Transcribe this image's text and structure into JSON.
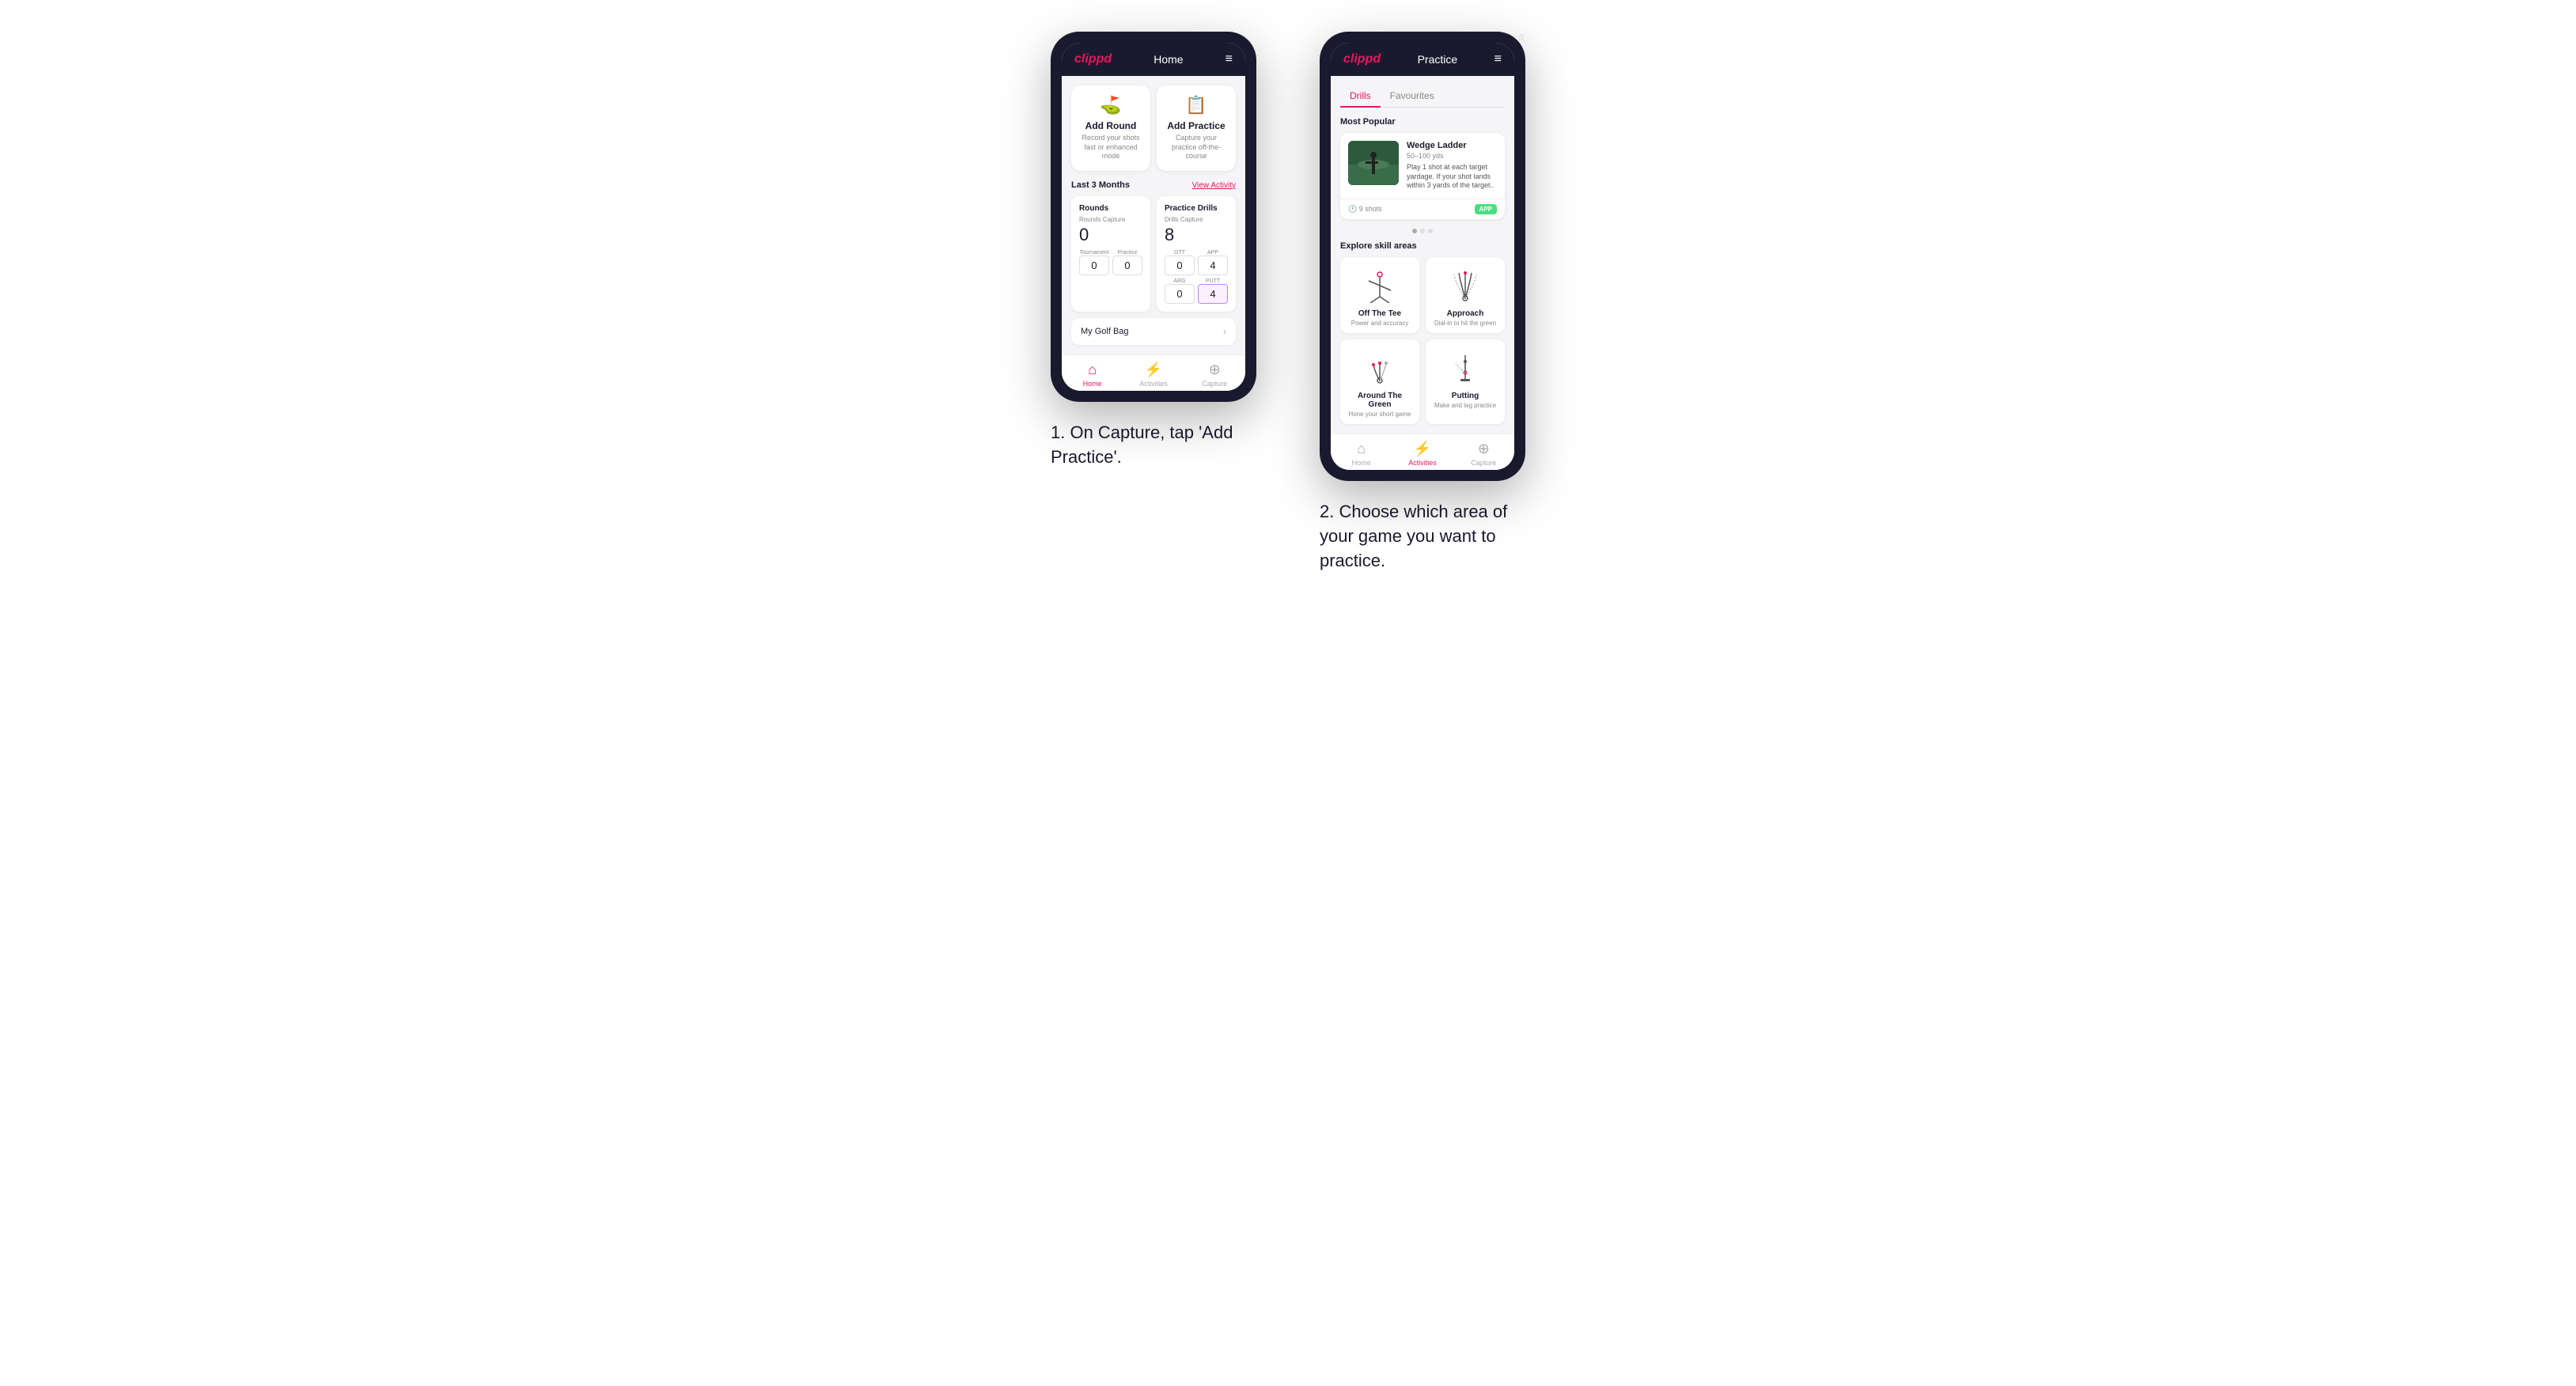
{
  "page": {
    "background": "#ffffff"
  },
  "phone1": {
    "header": {
      "logo": "clippd",
      "title": "Home",
      "menu_icon": "≡"
    },
    "action_cards": [
      {
        "id": "add-round",
        "icon": "⛳",
        "title": "Add Round",
        "subtitle": "Record your shots fast or enhanced mode"
      },
      {
        "id": "add-practice",
        "icon": "📋",
        "title": "Add Practice",
        "subtitle": "Capture your practice off-the-course"
      }
    ],
    "stats_section": {
      "label": "Last 3 Months",
      "view_activity": "View Activity",
      "rounds": {
        "title": "Rounds",
        "capture_label": "Rounds Capture",
        "value": "0",
        "tournament_label": "Tournament",
        "tournament_value": "0",
        "practice_label": "Practice",
        "practice_value": "0"
      },
      "practice_drills": {
        "title": "Practice Drills",
        "capture_label": "Drills Capture",
        "value": "8",
        "ott_label": "OTT",
        "ott_value": "0",
        "app_label": "APP",
        "app_value": "4",
        "arg_label": "ARG",
        "arg_value": "0",
        "putt_label": "PUTT",
        "putt_value": "4"
      }
    },
    "golf_bag": {
      "label": "My Golf Bag"
    },
    "bottom_nav": [
      {
        "label": "Home",
        "icon": "⌂",
        "active": true
      },
      {
        "label": "Activities",
        "icon": "⚡",
        "active": false
      },
      {
        "label": "Capture",
        "icon": "⊕",
        "active": false
      }
    ]
  },
  "phone2": {
    "header": {
      "logo": "clippd",
      "title": "Practice",
      "menu_icon": "≡"
    },
    "tabs": [
      {
        "label": "Drills",
        "active": true
      },
      {
        "label": "Favourites",
        "active": false
      }
    ],
    "most_popular_label": "Most Popular",
    "featured_drill": {
      "title": "Wedge Ladder",
      "yardage": "50–100 yds",
      "description": "Play 1 shot at each target yardage. If your shot lands within 3 yards of the target..",
      "shots_label": "9 shots",
      "badge": "APP"
    },
    "explore_label": "Explore skill areas",
    "skill_areas": [
      {
        "id": "off-the-tee",
        "title": "Off The Tee",
        "subtitle": "Power and accuracy"
      },
      {
        "id": "approach",
        "title": "Approach",
        "subtitle": "Dial-in to hit the green"
      },
      {
        "id": "around-the-green",
        "title": "Around The Green",
        "subtitle": "Hone your short game"
      },
      {
        "id": "putting",
        "title": "Putting",
        "subtitle": "Make and lag practice"
      }
    ],
    "bottom_nav": [
      {
        "label": "Home",
        "icon": "⌂",
        "active": false
      },
      {
        "label": "Activities",
        "icon": "⚡",
        "active": true
      },
      {
        "label": "Capture",
        "icon": "⊕",
        "active": false
      }
    ]
  },
  "captions": {
    "phone1": "1. On Capture, tap 'Add Practice'.",
    "phone2": "2. Choose which area of your game you want to practice."
  }
}
